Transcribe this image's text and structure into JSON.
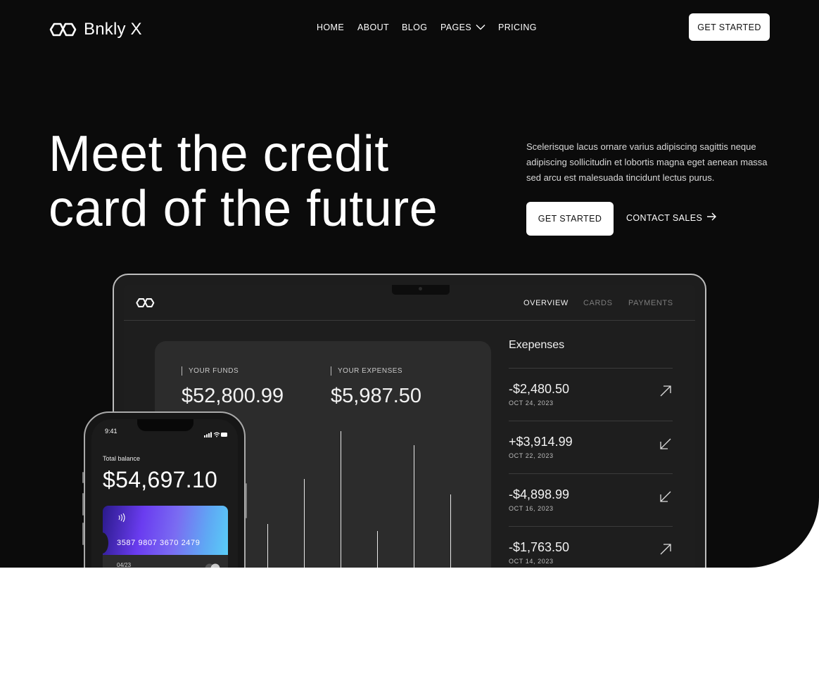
{
  "brand": {
    "name": "Bnkly X",
    "logo_icon": "infinity-hexagon-logo"
  },
  "nav": {
    "items": [
      {
        "label": "HOME"
      },
      {
        "label": "ABOUT"
      },
      {
        "label": "BLOG"
      },
      {
        "label": "PAGES",
        "icon": "chevron-down-icon"
      },
      {
        "label": "PRICING"
      }
    ],
    "cta_label": "GET STARTED"
  },
  "hero": {
    "headline_line1": "Meet the credit",
    "headline_line2": "card of the future",
    "description": "Scelerisque lacus ornare varius adipiscing sagittis neque adipiscing sollicitudin et lobortis magna eget aenean massa sed arcu est malesuada tincidunt lectus purus.",
    "primary_cta": "GET STARTED",
    "secondary_cta": "CONTACT SALES"
  },
  "dashboard": {
    "tabs": [
      {
        "label": "OVERVIEW",
        "active": true
      },
      {
        "label": "CARDS",
        "active": false
      },
      {
        "label": "PAYMENTS",
        "active": false
      }
    ],
    "funds_label": "YOUR FUNDS",
    "funds_value": "$52,800.99",
    "expenses_label": "YOUR EXPENSES",
    "expenses_value": "$5,987.50",
    "expenses_title": "Exepenses",
    "transactions": [
      {
        "amount": "-$2,480.50",
        "date": "OCT 24, 2023",
        "icon": "arrow-up-right-icon"
      },
      {
        "amount": "+$3,914.99",
        "date": "OCT 22, 2023",
        "icon": "arrow-down-left-icon"
      },
      {
        "amount": "-$4,898.99",
        "date": "OCT 16, 2023",
        "icon": "arrow-down-left-icon"
      },
      {
        "amount": "-$1,763.50",
        "date": "OCT 14, 2023",
        "icon": "arrow-up-right-icon"
      }
    ]
  },
  "phone": {
    "time": "9:41",
    "balance_label": "Total balance",
    "balance_value": "$54,697.10",
    "card_number": "3587 9807 3670 2479",
    "card_expiry": "04/23"
  },
  "colors": {
    "background": "#0b0b0b",
    "panel": "#2c2c2c",
    "accent_gradient_start": "#6a3cf0",
    "accent_gradient_end": "#58d7f8"
  }
}
